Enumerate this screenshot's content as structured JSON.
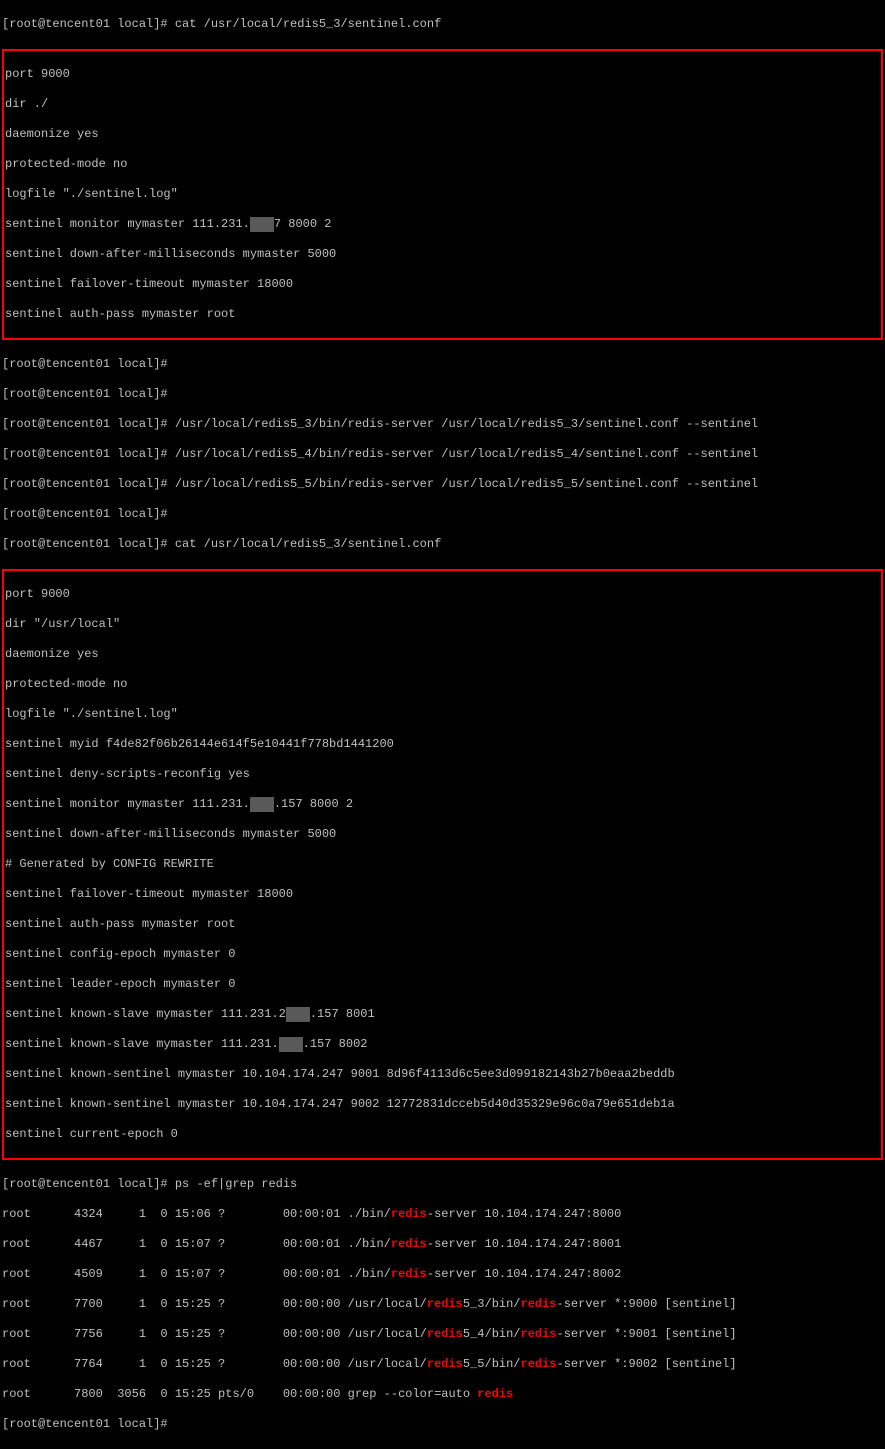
{
  "prompt": "[root@tencent01 local]# ",
  "cmd1": "cat /usr/local/redis5_3/sentinel.conf",
  "box1": {
    "l1": "port 9000",
    "l2": "dir ./",
    "l3": "daemonize yes",
    "l4": "protected-mode no",
    "l5": "logfile \"./sentinel.log\"",
    "l6a": "sentinel monitor mymaster 111.231.",
    "l6b": "7 8000 2",
    "l7": "sentinel down-after-milliseconds mymaster 5000",
    "l8": "sentinel failover-timeout mymaster 18000",
    "l9": "sentinel auth-pass mymaster root"
  },
  "mid": {
    "cmd2": "/usr/local/redis5_3/bin/redis-server /usr/local/redis5_3/sentinel.conf --sentinel",
    "cmd3": "/usr/local/redis5_4/bin/redis-server /usr/local/redis5_4/sentinel.conf --sentinel",
    "cmd4": "/usr/local/redis5_5/bin/redis-server /usr/local/redis5_5/sentinel.conf --sentinel",
    "cmd5": "cat /usr/local/redis5_3/sentinel.conf"
  },
  "box2": {
    "l1": "port 9000",
    "l2": "dir \"/usr/local\"",
    "l3": "daemonize yes",
    "l4": "protected-mode no",
    "l5": "logfile \"./sentinel.log\"",
    "l6": "sentinel myid f4de82f06b26144e614f5e10441f778bd1441200",
    "l7": "sentinel deny-scripts-reconfig yes",
    "l8a": "sentinel monitor mymaster 111.231.",
    "l8b": ".157 8000 2",
    "l9": "sentinel down-after-milliseconds mymaster 5000",
    "l10": "# Generated by CONFIG REWRITE",
    "l11": "sentinel failover-timeout mymaster 18000",
    "l12": "sentinel auth-pass mymaster root",
    "l13": "sentinel config-epoch mymaster 0",
    "l14": "sentinel leader-epoch mymaster 0",
    "l15a": "sentinel known-slave mymaster 111.231.2",
    "l15b": ".157 8001",
    "l16a": "sentinel known-slave mymaster 111.231.",
    "l16b": ".157 8002",
    "l17": "sentinel known-sentinel mymaster 10.104.174.247 9001 8d96f4113d6c5ee3d099182143b27b0eaa2beddb",
    "l18": "sentinel known-sentinel mymaster 10.104.174.247 9002 12772831dcceb5d40d35329e96c0a79e651deb1a",
    "l19": "sentinel current-epoch 0"
  },
  "cmd6": "ps -ef|grep redis",
  "ps": {
    "r1a": "root      4324     1  0 15:06 ?        00:00:01 ./bin/",
    "r1b": "-server 10.104.174.247:8000",
    "r2a": "root      4467     1  0 15:07 ?        00:00:01 ./bin/",
    "r2b": "-server 10.104.174.247:8001",
    "r3a": "root      4509     1  0 15:07 ?        00:00:01 ./bin/",
    "r3b": "-server 10.104.174.247:8002",
    "r4a": "root      7700     1  0 15:25 ?        00:00:00 /usr/local/",
    "r4b": "5_3/bin/",
    "r4c": "-server *:9000 [sentinel]",
    "r5a": "root      7756     1  0 15:25 ?        00:00:00 /usr/local/",
    "r5b": "5_4/bin/",
    "r5c": "-server *:9001 [sentinel]",
    "r6a": "root      7764     1  0 15:25 ?        00:00:00 /usr/local/",
    "r6b": "5_5/bin/",
    "r6c": "-server *:9002 [sentinel]",
    "r7a": "root      7800  3056  0 15:25 pts/0    00:00:00 grep --color=auto ",
    "hl": "redis"
  }
}
